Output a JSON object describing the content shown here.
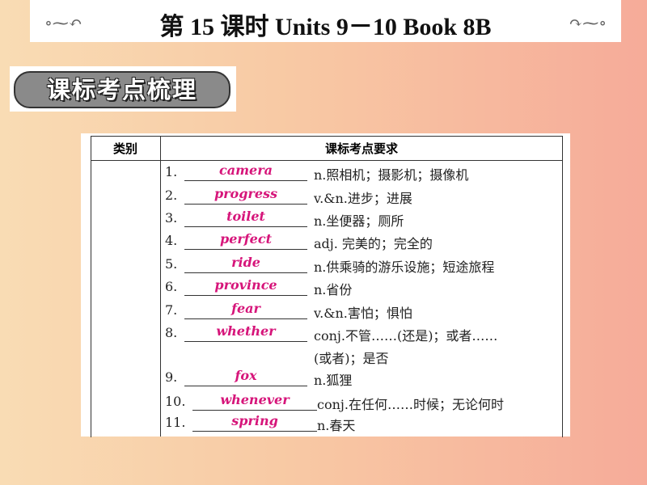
{
  "header": {
    "title": "第 15 课时   Units 9－10 Book 8B",
    "ornament_left": "swirl-ornament",
    "ornament_right": "swirl-ornament"
  },
  "section_badge": "课标考点梳理",
  "table": {
    "columns": [
      "类别",
      "课标考点要求"
    ],
    "rows": [
      {
        "num": "1.",
        "answer": "camera",
        "definition": "n.照相机；摄影机；摄像机"
      },
      {
        "num": "2.",
        "answer": "progress",
        "definition": "v.&n.进步；进展"
      },
      {
        "num": "3.",
        "answer": "toilet",
        "definition": "n.坐便器；厕所"
      },
      {
        "num": "4.",
        "answer": "perfect",
        "definition": "adj. 完美的；完全的"
      },
      {
        "num": "5.",
        "answer": "ride",
        "definition": "n.供乘骑的游乐设施；短途旅程"
      },
      {
        "num": "6.",
        "answer": "province",
        "definition": "n.省份"
      },
      {
        "num": "7.",
        "answer": "fear",
        "definition": "v.&n.害怕；惧怕"
      },
      {
        "num": "8.",
        "answer": "whether",
        "definition": "conj.不管……(还是)；或者……",
        "definition_cont": "(或者)；是否"
      },
      {
        "num": "9.",
        "answer": "fox",
        "definition": "n.狐狸"
      },
      {
        "num": "10.",
        "answer": "whenever",
        "definition": "conj.在任何……时候；无论何时"
      },
      {
        "num": "11.",
        "answer": "spring",
        "definition": "n.春天"
      }
    ]
  },
  "colors": {
    "answer": "#d6157a"
  }
}
